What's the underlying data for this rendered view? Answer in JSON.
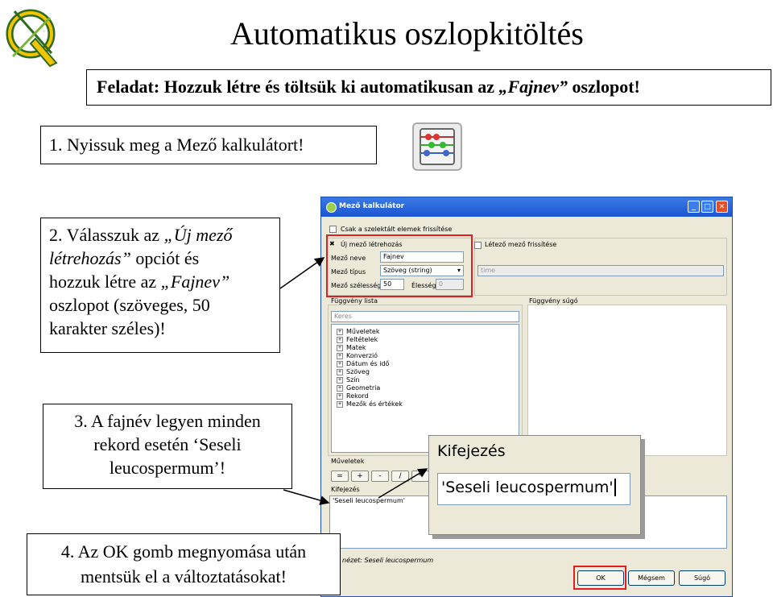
{
  "slide": {
    "title": "Automatikus oszlopkitöltés",
    "task": {
      "prefix": "Feladat: Hozzuk létre és töltsük ki automatikusan az ",
      "emph": "„Fajnev”",
      "suffix": " oszlopot!"
    },
    "step1": "1. Nyissuk meg a Mező kalkulátort!",
    "step2": {
      "t1": "2. Válasszuk az ",
      "e1": "„Új mező",
      "t2": "",
      "e2": "létrehozás”",
      "t3": " opciót és",
      "t4": "hozzuk létre az ",
      "e3": "„Fajnev”",
      "t5": "oszlopot (szöveges, 50",
      "t6": "karakter széles)!"
    },
    "step3": {
      "l1": "3. A fajnév legyen minden",
      "l2": "rekord esetén ‘Seseli",
      "l3": "leucospermum’!"
    },
    "step4": {
      "l1": "4. Az OK gomb megnyomása után",
      "l2": "mentsük el a változtatásokat!"
    }
  },
  "dialog": {
    "title": "Mező kalkulátor",
    "only_selected": "Csak a szelektált elemek frissítése",
    "new_field": "Új mező létrehozás",
    "update_existing": "Létező mező frissítése",
    "field_name_label": "Mező neve",
    "field_name_value": "Fajnev",
    "field_type_label": "Mező típus",
    "field_type_value": "Szöveg (string)",
    "field_width_label": "Mező szélesség",
    "field_width_value": "50",
    "precision_label": "Élesség",
    "precision_value": "0",
    "existing_field_value": "time",
    "function_list_label": "Függvény lista",
    "function_help_label": "Függvény súgó",
    "search_placeholder": "Keres",
    "functions": [
      "Műveletek",
      "Feltételek",
      "Matek",
      "Konverzió",
      "Dátum és idő",
      "Szöveg",
      "Szín",
      "Geometria",
      "Rekord",
      "Mezők és értékek"
    ],
    "operators_label": "Műveletek",
    "operators": [
      "=",
      "+",
      "-",
      "/",
      "*"
    ],
    "expression_label": "Kifejezés",
    "expression_value": "'Seseli leucospermum'",
    "output_preview": "nézet: Seseli leucospermum",
    "ok": "OK",
    "cancel": "Mégsem",
    "help": "Súgó"
  },
  "zoom": {
    "label": "Kifejezés",
    "value": "'Seseli leucospermum'"
  },
  "icons": [
    "qgis-logo-icon",
    "field-calculator-icon",
    "minimize-icon",
    "maximize-icon",
    "close-icon"
  ]
}
